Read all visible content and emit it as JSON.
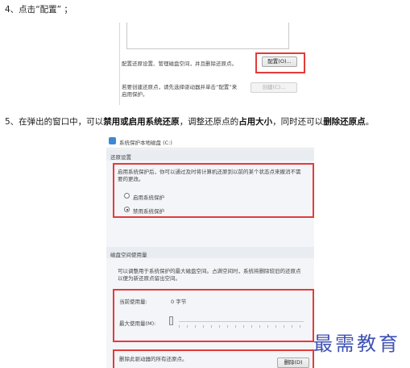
{
  "step4": {
    "prefix": "4、点击",
    "keyword": "“配置”",
    "suffix": "；"
  },
  "dialog1": {
    "config_text": "配置还原设置、管理磁盘空间，并且删除还原点。",
    "config_button": "配置(O)...",
    "create_text": "若要创建还原点，请先选择驱动器并单击“配置”来",
    "create_text2": "启用保护。",
    "create_button": "创建(C)..."
  },
  "step5": {
    "part1": "5、在弹出的窗口中，可以",
    "bold1": "禁用或启用系统还原",
    "part2": "，调整还原点的",
    "bold2": "占用大小",
    "part3": "，同时还可以",
    "bold3": "删除还原点",
    "part4": "。"
  },
  "dialog2": {
    "title": "系统保护本地磁盘 (C:)",
    "restore_section": "还原设置",
    "restore_desc1": "启用系统保护后，你可以通过及时将计算机还原到以前的某个状态点来撤消不需",
    "restore_desc2": "要的更改。",
    "enable_option": "启用系统保护",
    "disable_option": "禁用系统保护",
    "selected_option": "disable",
    "disk_section": "磁盘空间使用量",
    "disk_desc1": "可以调整用于系统保护的最大磁盘空间。占满空间时，系统将删除较旧的还原点",
    "disk_desc2": "以便为新还原点留出空间。",
    "current_usage_label": "当前使用量:",
    "current_usage_value": "0 字节",
    "max_usage_label": "最大使用量(M):",
    "max_usage_level": 0,
    "delete_text": "删除此驱动器的所有还原点。",
    "delete_button": "删除(D)"
  },
  "watermark": "最需教育",
  "colors": {
    "highlight": "#e53a3a",
    "watermark": "#3f52b5"
  }
}
